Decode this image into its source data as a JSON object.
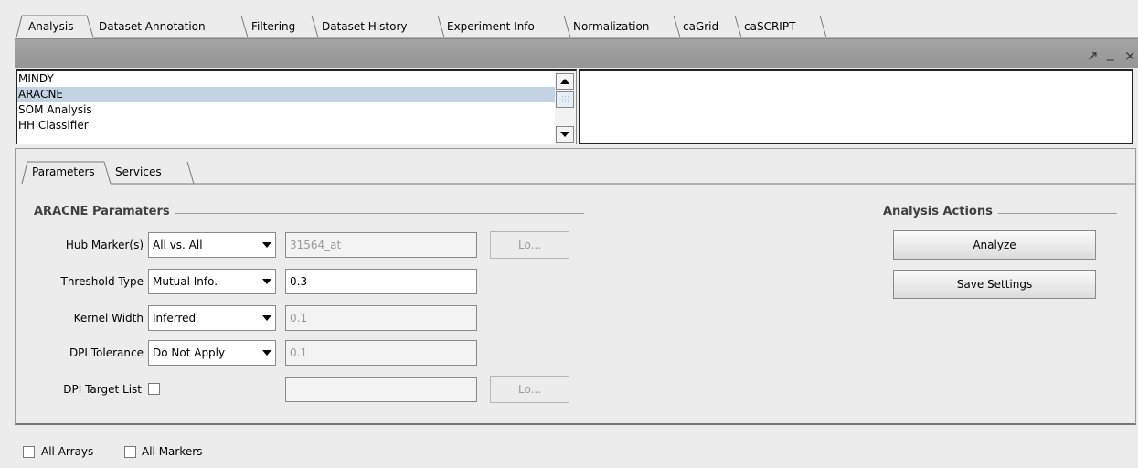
{
  "top_tabs": [
    {
      "label": "Analysis",
      "active": true
    },
    {
      "label": "Dataset Annotation"
    },
    {
      "label": "Filtering"
    },
    {
      "label": "Dataset History"
    },
    {
      "label": "Experiment Info"
    },
    {
      "label": "Normalization"
    },
    {
      "label": "caGrid"
    },
    {
      "label": "caSCRIPT"
    }
  ],
  "window_controls": {
    "maximize": "↗",
    "minimize": "_",
    "close": "×"
  },
  "algorithm_list": {
    "items": [
      "MINDY",
      "ARACNE",
      "SOM Analysis",
      "HH Classifier"
    ],
    "selected": "ARACNE"
  },
  "sub_tabs": [
    {
      "label": "Parameters",
      "active": true
    },
    {
      "label": "Services"
    }
  ],
  "params": {
    "section_title": "ARACNE Paramaters",
    "hub_marker": {
      "label": "Hub Marker(s)",
      "value": "All vs. All",
      "field": "31564_at",
      "button": "Lo..."
    },
    "threshold_type": {
      "label": "Threshold Type",
      "value": "Mutual Info.",
      "field": "0.3"
    },
    "kernel_width": {
      "label": "Kernel Width",
      "value": "Inferred",
      "field": "0.1"
    },
    "dpi_tolerance": {
      "label": "DPI Tolerance",
      "value": "Do Not Apply",
      "field": "0.1"
    },
    "dpi_target_list": {
      "label": "DPI Target List",
      "field": "",
      "button": "Lo...",
      "checked": false
    }
  },
  "actions": {
    "section_title": "Analysis Actions",
    "analyze": "Analyze",
    "save_settings": "Save Settings"
  },
  "bottom": {
    "all_arrays": {
      "label": "All Arrays",
      "checked": false
    },
    "all_markers": {
      "label": "All Markers",
      "checked": false
    }
  }
}
